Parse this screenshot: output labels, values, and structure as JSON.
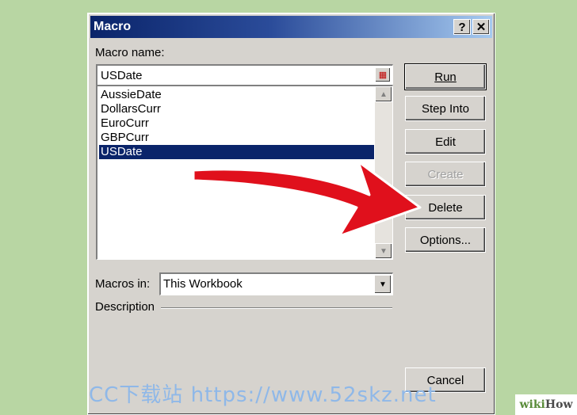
{
  "window": {
    "title": "Macro",
    "help_glyph": "?",
    "close_glyph": "✕"
  },
  "macro_name": {
    "label": "Macro name:",
    "value": "USDate"
  },
  "macro_list": {
    "items": [
      "AussieDate",
      "DollarsCurr",
      "EuroCurr",
      "GBPCurr",
      "USDate"
    ],
    "selected": "USDate"
  },
  "buttons": {
    "run": "Run",
    "step_into": "Step Into",
    "edit": "Edit",
    "create": "Create",
    "delete": "Delete",
    "options": "Options...",
    "cancel": "Cancel"
  },
  "macros_in": {
    "label": "Macros in:",
    "value": "This Workbook"
  },
  "description": {
    "label": "Description"
  },
  "overlay": {
    "arrow_color": "#e0101c",
    "watermark": "CC下载站 https://www.52skz.net",
    "brand_part1": "wiki",
    "brand_part2": "How"
  }
}
